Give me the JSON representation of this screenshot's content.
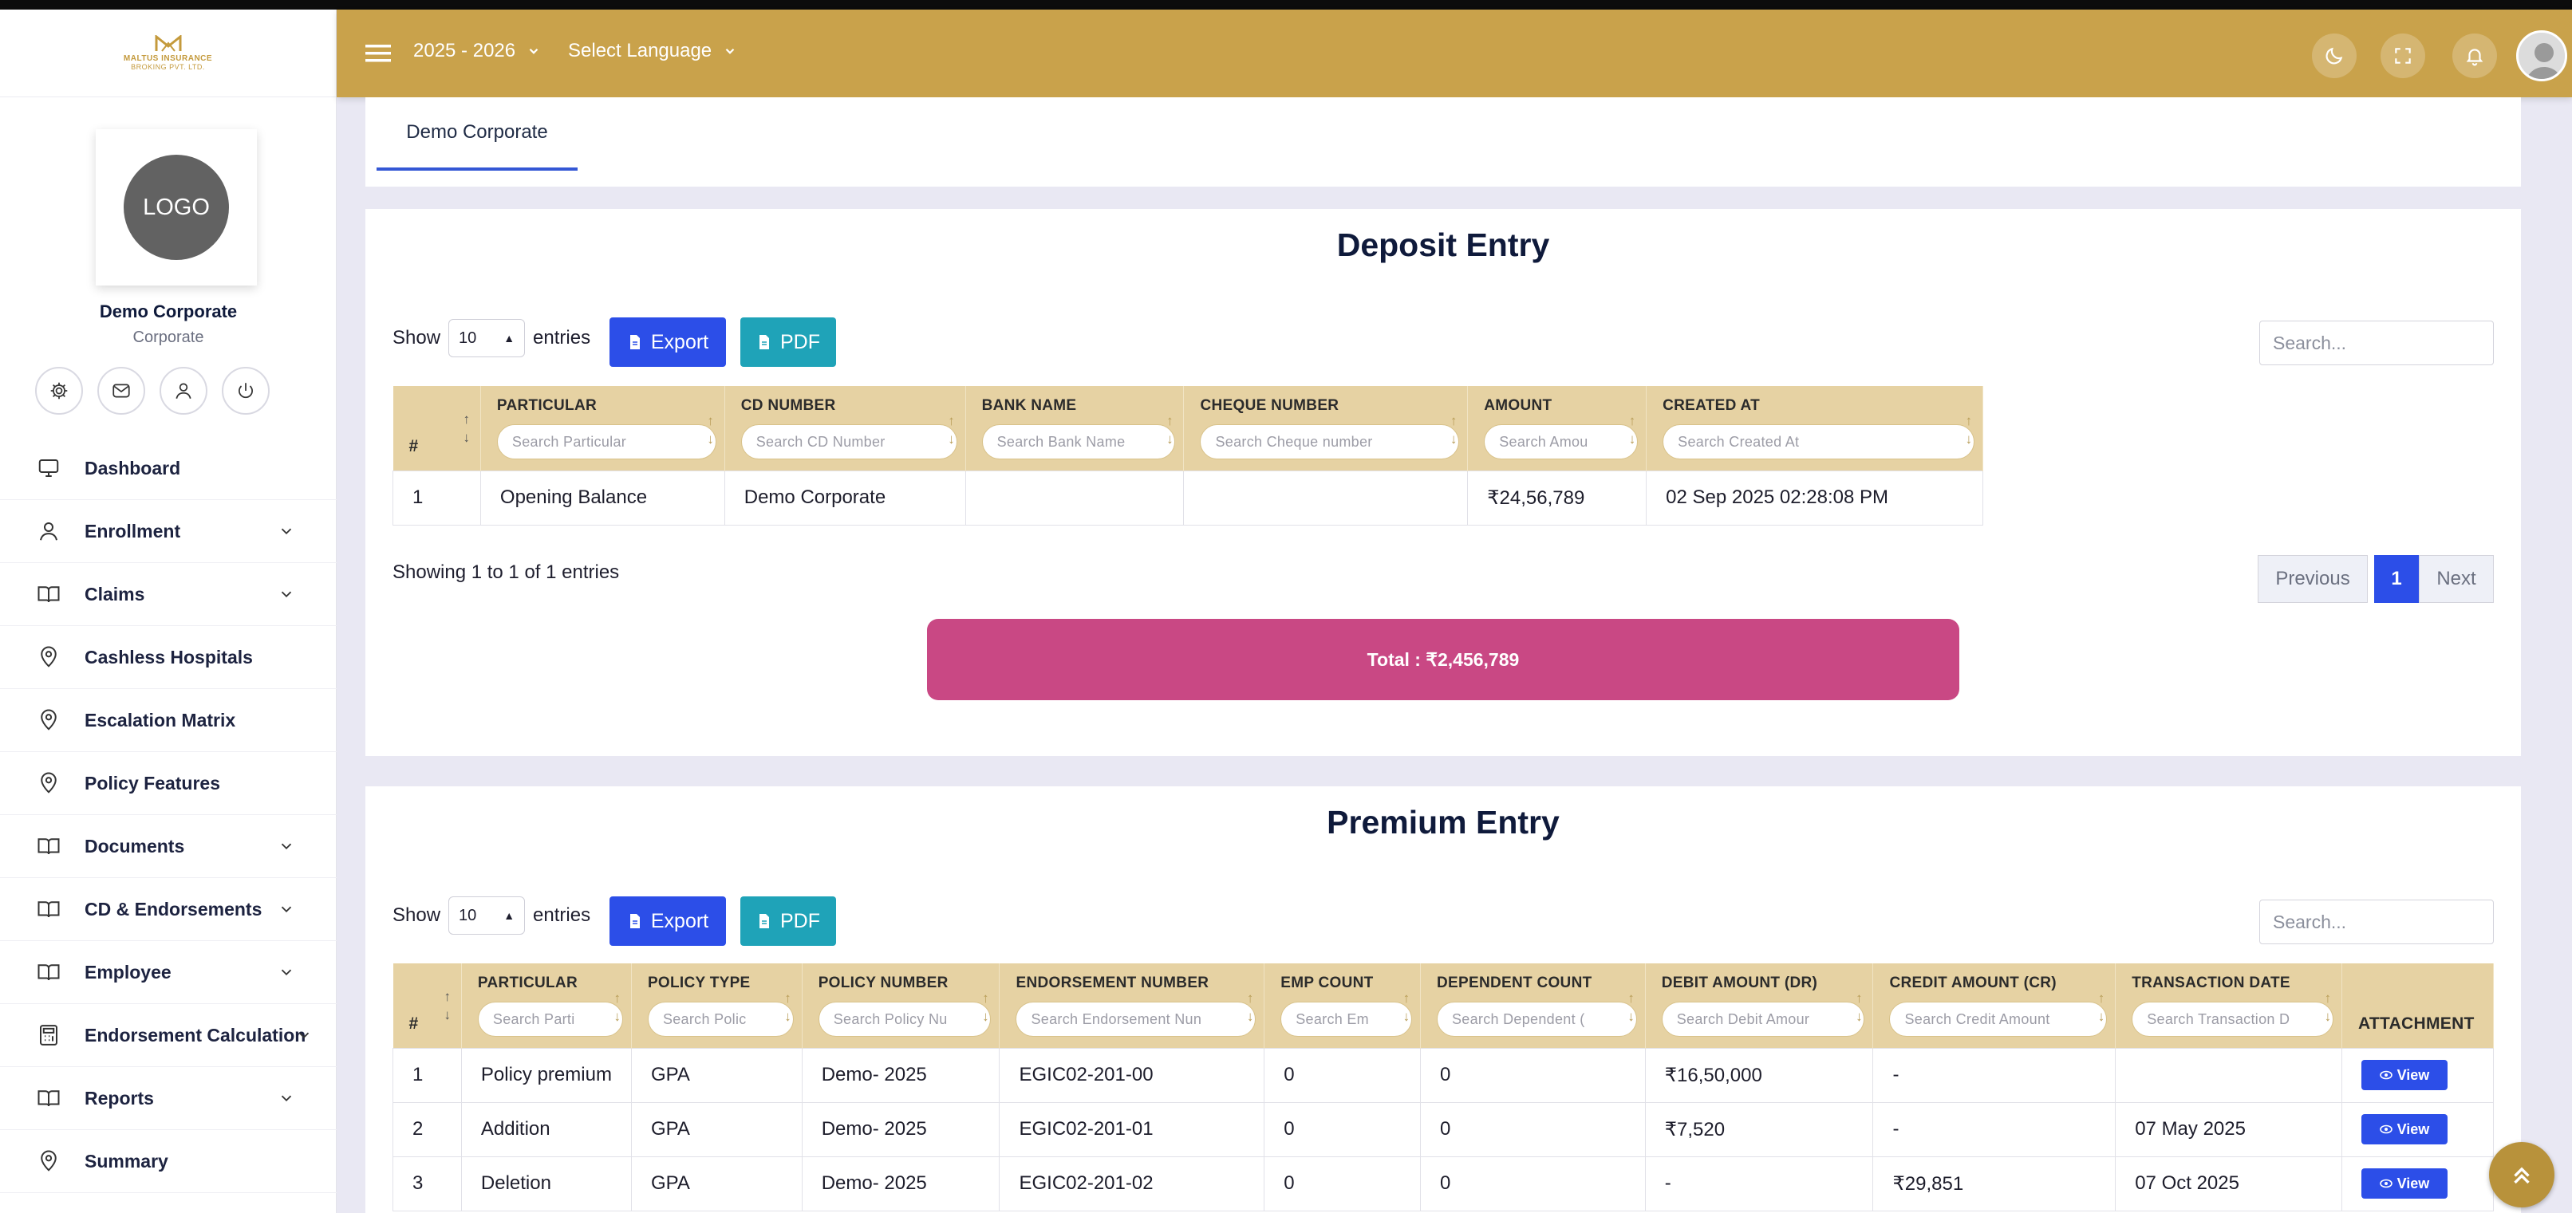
{
  "brand": {
    "name": "MALTUS INSURANCE",
    "sub": "BROKING PVT. LTD."
  },
  "profile": {
    "logo_text": "LOGO",
    "name": "Demo Corporate",
    "role": "Corporate"
  },
  "sidebar": {
    "items": [
      {
        "label": "Dashboard",
        "icon": "monitor-icon",
        "has_submenu": false
      },
      {
        "label": "Enrollment",
        "icon": "user-icon",
        "has_submenu": true
      },
      {
        "label": "Claims",
        "icon": "book-icon",
        "has_submenu": true
      },
      {
        "label": "Cashless Hospitals",
        "icon": "location-pin-icon",
        "has_submenu": false
      },
      {
        "label": "Escalation Matrix",
        "icon": "location-pin-icon",
        "has_submenu": false
      },
      {
        "label": "Policy Features",
        "icon": "location-pin-icon",
        "has_submenu": false
      },
      {
        "label": "Documents",
        "icon": "book-icon",
        "has_submenu": true
      },
      {
        "label": "CD & Endorsements",
        "icon": "book-icon",
        "has_submenu": true
      },
      {
        "label": "Employee",
        "icon": "book-icon",
        "has_submenu": true
      },
      {
        "label": "Endorsement Calculation",
        "icon": "calculator-icon",
        "has_submenu": true
      },
      {
        "label": "Reports",
        "icon": "book-icon",
        "has_submenu": true
      },
      {
        "label": "Summary",
        "icon": "location-pin-icon",
        "has_submenu": false
      }
    ]
  },
  "header": {
    "year": "2025 - 2026",
    "language": "Select Language"
  },
  "tabs": [
    {
      "label": "Demo Corporate",
      "active": true
    }
  ],
  "deposit": {
    "title": "Deposit Entry",
    "show_label": "Show",
    "entries_label": "entries",
    "page_length": "10",
    "export_label": "Export",
    "pdf_label": "PDF",
    "search_placeholder": "Search...",
    "columns": [
      {
        "name": "#",
        "search": ""
      },
      {
        "name": "PARTICULAR",
        "search": "Search Particular"
      },
      {
        "name": "CD NUMBER",
        "search": "Search CD Number"
      },
      {
        "name": "BANK NAME",
        "search": "Search Bank Name"
      },
      {
        "name": "CHEQUE NUMBER",
        "search": "Search Cheque number"
      },
      {
        "name": "AMOUNT",
        "search": "Search Amou"
      },
      {
        "name": "CREATED AT",
        "search": "Search Created At"
      }
    ],
    "rows": [
      [
        "1",
        "Opening Balance",
        "Demo Corporate",
        "",
        "",
        "₹24,56,789",
        "02 Sep 2025 02:28:08 PM"
      ]
    ],
    "showing": "Showing 1 to 1 of 1 entries",
    "pager": {
      "previous": "Previous",
      "page": "1",
      "next": "Next"
    },
    "total": "Total : ₹2,456,789"
  },
  "premium": {
    "title": "Premium Entry",
    "show_label": "Show",
    "entries_label": "entries",
    "page_length": "10",
    "export_label": "Export",
    "pdf_label": "PDF",
    "search_placeholder": "Search...",
    "columns": [
      {
        "name": "#",
        "search": ""
      },
      {
        "name": "PARTICULAR",
        "search": "Search Parti"
      },
      {
        "name": "POLICY TYPE",
        "search": "Search Polic"
      },
      {
        "name": "POLICY NUMBER",
        "search": "Search Policy Nu"
      },
      {
        "name": "ENDORSEMENT NUMBER",
        "search": "Search Endorsement Nun"
      },
      {
        "name": "EMP COUNT",
        "search": "Search Em"
      },
      {
        "name": "DEPENDENT COUNT",
        "search": "Search Dependent ("
      },
      {
        "name": "DEBIT AMOUNT (DR)",
        "search": "Search Debit Amour"
      },
      {
        "name": "CREDIT AMOUNT (CR)",
        "search": "Search Credit Amount"
      },
      {
        "name": "TRANSACTION DATE",
        "search": "Search Transaction D"
      },
      {
        "name": "ATTACHMENT",
        "search": ""
      }
    ],
    "view_label": "View",
    "rows": [
      [
        "1",
        "Policy premium",
        "GPA",
        "Demo- 2025",
        "EGIC02-201-00",
        "0",
        "0",
        "₹16,50,000",
        "-",
        ""
      ],
      [
        "2",
        "Addition",
        "GPA",
        "Demo- 2025",
        "EGIC02-201-01",
        "0",
        "0",
        "₹7,520",
        "-",
        "07 May 2025"
      ],
      [
        "3",
        "Deletion",
        "GPA",
        "Demo- 2025",
        "EGIC02-201-02",
        "0",
        "0",
        "-",
        "₹29,851",
        "07 Oct 2025"
      ]
    ]
  },
  "colors": {
    "header": "#c9a24b",
    "accent": "#2c4ee8",
    "pdf": "#1fa3b8",
    "total": "#c94884",
    "table_header": "#e6d2a3"
  }
}
